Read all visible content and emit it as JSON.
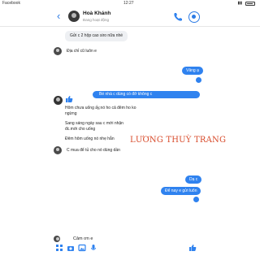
{
  "statusbar": {
    "carrier": "Facebook",
    "time": "12:27"
  },
  "header": {
    "back_glyph": "‹",
    "name": "Hoà Khánh",
    "status": "Đang hoạt động"
  },
  "messages": {
    "m1": "Gửi c 2 hộp cao siro nữa nhé",
    "m2": "Địa chỉ cũ luôn e",
    "out1": "Vâng ạ",
    "reply_quote": "Bé nhà c dùng có đỡ không c",
    "r1": "Hôm chưa uống ấy,nó ho cả đêm ho ko ngừng",
    "r2": "Sang sáng ngày sau c mới nhận đc.mới cho uống",
    "r3": "Đêm hôm uống nó nhẹ hẳn",
    "r4": "C mua để tủ cho nó dùng dần",
    "out2": "Dạ c",
    "out3": "Để nay e gửi luôn",
    "last": "Cảm ơn e",
    "signature": "LƯƠNG THUỲ TRANG"
  },
  "colors": {
    "accent": "#2f82ef",
    "signature": "#d84a2a"
  }
}
